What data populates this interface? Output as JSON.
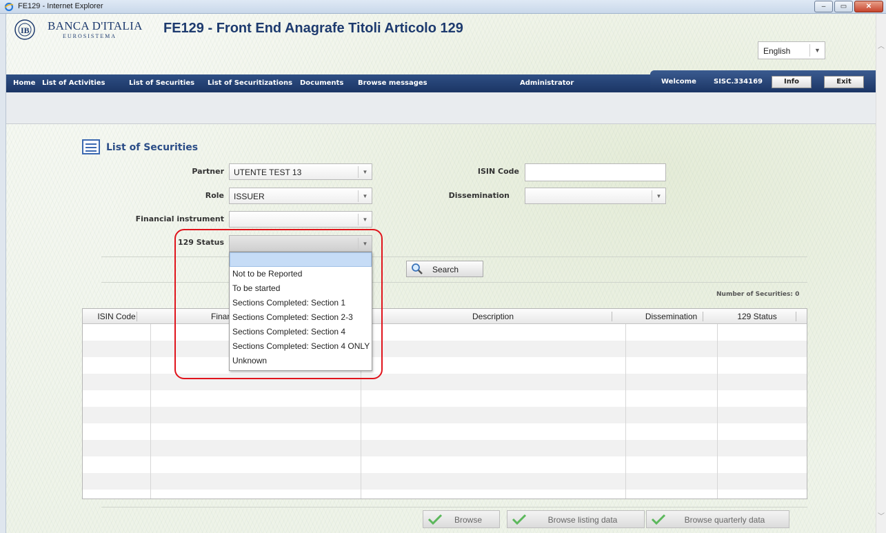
{
  "window": {
    "title": "FE129 - Internet Explorer",
    "min": "–",
    "max": "▭",
    "close": "✕"
  },
  "header": {
    "brand_name": "BANCA D'ITALIA",
    "brand_sub": "EUROSISTEMA",
    "app_title": "FE129 - Front End Anagrafe Titoli Articolo 129",
    "language": "English"
  },
  "nav": {
    "items": [
      "Home",
      "List of Activities",
      "List of Securities",
      "List of Securitizations",
      "Documents",
      "Browse messages",
      "Administrator"
    ],
    "welcome": "Welcome",
    "user": "SISC.334169",
    "info": "Info",
    "exit": "Exit"
  },
  "page": {
    "title": "List of Securities",
    "form": {
      "partner_label": "Partner",
      "partner_value": "UTENTE TEST 13",
      "role_label": "Role",
      "role_value": "ISSUER",
      "fin_label": "Financial instrument",
      "fin_value": "",
      "status_label": "129 Status",
      "status_value": "",
      "isin_label": "ISIN Code",
      "isin_value": "",
      "dissemination_label": "Dissemination",
      "dissemination_value": ""
    },
    "search": "Search",
    "count": "Number of Securities: 0",
    "table": {
      "columns": [
        "ISIN Code",
        "Finar",
        "Description",
        "Dissemination",
        "129 Status"
      ]
    },
    "dropdown_options": [
      "",
      "Not to be Reported",
      "To be started",
      "Sections Completed: Section 1",
      "Sections Completed: Section 2-3",
      "Sections Completed: Section 4",
      "Sections Completed: Section 4 ONLY",
      "Unknown"
    ],
    "buttons": {
      "browse": "Browse",
      "browse_listing": "Browse listing data",
      "browse_quarterly": "Browse quarterly data"
    }
  },
  "colors": {
    "nav": "#1b3564",
    "highlight": "#e0131b",
    "title": "#1d3a6e"
  }
}
